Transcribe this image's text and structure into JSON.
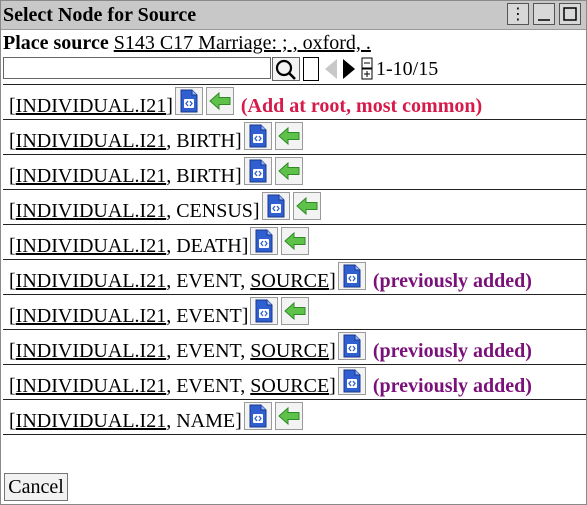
{
  "window": {
    "title": "Select Node for Source",
    "menu_glyph": "⋮",
    "minimize_glyph": "_",
    "maximize_glyph": "□"
  },
  "place": {
    "label": "Place source",
    "link": "S143 C17 Marriage: ; , oxford, ."
  },
  "toolbar": {
    "search_value": "",
    "search_placeholder": "",
    "range": "1-10/15",
    "page_plus": "+",
    "page_minus": "-"
  },
  "rows": [
    {
      "link": "INDIVIDUAL.I21",
      "suffix": "",
      "extra_link": "",
      "note": "(Add at root, most common)",
      "note_type": "root",
      "has_add": true
    },
    {
      "link": "INDIVIDUAL.I21",
      "suffix": ", BIRTH",
      "extra_link": "",
      "note": "",
      "note_type": "",
      "has_add": true
    },
    {
      "link": "INDIVIDUAL.I21",
      "suffix": ", BIRTH",
      "extra_link": "",
      "note": "",
      "note_type": "",
      "has_add": true
    },
    {
      "link": "INDIVIDUAL.I21",
      "suffix": ", CENSUS",
      "extra_link": "",
      "note": "",
      "note_type": "",
      "has_add": true
    },
    {
      "link": "INDIVIDUAL.I21",
      "suffix": ", DEATH",
      "extra_link": "",
      "note": "",
      "note_type": "",
      "has_add": true
    },
    {
      "link": "INDIVIDUAL.I21",
      "suffix": ", EVENT, ",
      "extra_link": "SOURCE",
      "note": "(previously added)",
      "note_type": "prev",
      "has_add": false
    },
    {
      "link": "INDIVIDUAL.I21",
      "suffix": ", EVENT",
      "extra_link": "",
      "note": "",
      "note_type": "",
      "has_add": true
    },
    {
      "link": "INDIVIDUAL.I21",
      "suffix": ", EVENT, ",
      "extra_link": "SOURCE",
      "note": "(previously added)",
      "note_type": "prev",
      "has_add": false
    },
    {
      "link": "INDIVIDUAL.I21",
      "suffix": ", EVENT, ",
      "extra_link": "SOURCE",
      "note": "(previously added)",
      "note_type": "prev",
      "has_add": false
    },
    {
      "link": "INDIVIDUAL.I21",
      "suffix": ", NAME",
      "extra_link": "",
      "note": "",
      "note_type": "",
      "has_add": true
    }
  ],
  "cancel_label": "Cancel",
  "colors": {
    "root_note": "#d61a4a",
    "prev_note": "#7a117a",
    "doc_icon": "#2f5fd0",
    "arrow_icon": "#5ec24a"
  },
  "icons": {
    "view": "code-document-icon",
    "add": "green-left-arrow-icon",
    "search": "magnifier-icon",
    "prev_page": "triangle-left-icon",
    "next_page": "triangle-right-icon"
  }
}
